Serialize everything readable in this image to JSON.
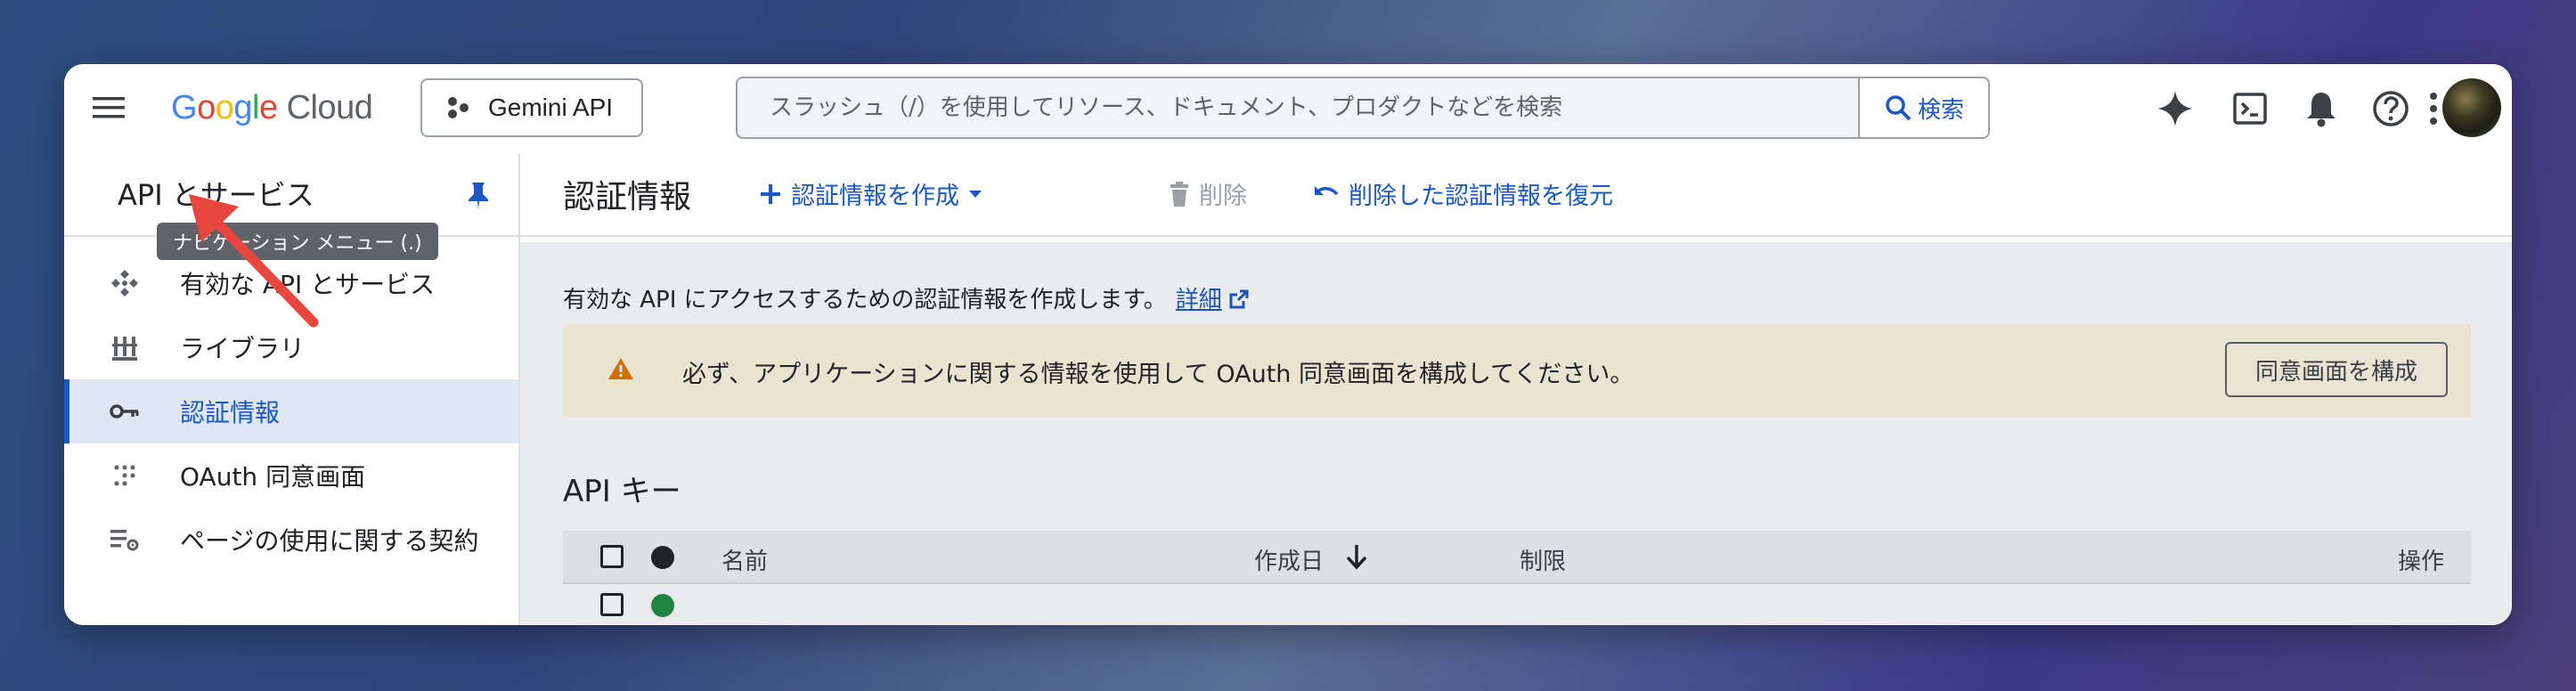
{
  "header": {
    "menu_icon": "hamburger-menu-icon",
    "logo": {
      "google": [
        "G",
        "o",
        "o",
        "g",
        "l",
        "e"
      ],
      "google_colors": [
        "#4285F4",
        "#EA4335",
        "#FBBC05",
        "#4285F4",
        "#34A853",
        "#EA4335"
      ],
      "cloud": "Cloud"
    },
    "project": {
      "name": "Gemini API",
      "icon": "project-nodes-icon"
    },
    "search": {
      "placeholder": "スラッシュ（/）を使用してリソース、ドキュメント、プロダクトなどを検索",
      "button_label": "検索"
    },
    "right_icons": [
      "gemini-sparkle-icon",
      "cloud-shell-icon",
      "notifications-bell-icon",
      "help-icon",
      "more-vert-icon"
    ]
  },
  "tooltip": {
    "text": "ナビゲーション メニュー (.)"
  },
  "sidebar": {
    "header_title": "API とサービス",
    "pin_icon": "pin-icon",
    "items": [
      {
        "label": "有効な API とサービス",
        "icon": "api-services-icon",
        "active": false
      },
      {
        "label": "ライブラリ",
        "icon": "library-icon",
        "active": false
      },
      {
        "label": "認証情報",
        "icon": "key-icon",
        "active": true
      },
      {
        "label": "OAuth 同意画面",
        "icon": "oauth-dots-icon",
        "active": false
      },
      {
        "label": "ページの使用に関する契約",
        "icon": "settings-list-icon",
        "active": false
      }
    ]
  },
  "main": {
    "title": "認証情報",
    "actions": {
      "create": "認証情報を作成",
      "delete": "削除",
      "restore": "削除した認証情報を復元"
    },
    "description": "有効な API にアクセスするための認証情報を作成します。",
    "details_link": "詳細",
    "banner": {
      "message": "必ず、アプリケーションに関する情報を使用して OAuth 同意画面を構成してください。",
      "button": "同意画面を構成",
      "color": "#fef7e0"
    },
    "api_keys": {
      "section_title": "API キー",
      "columns": {
        "name": "名前",
        "created": "作成日",
        "restrictions": "制限",
        "actions": "操作"
      }
    }
  },
  "colors": {
    "accent": "#1a57c7",
    "annotation_arrow": "#e8453c"
  }
}
